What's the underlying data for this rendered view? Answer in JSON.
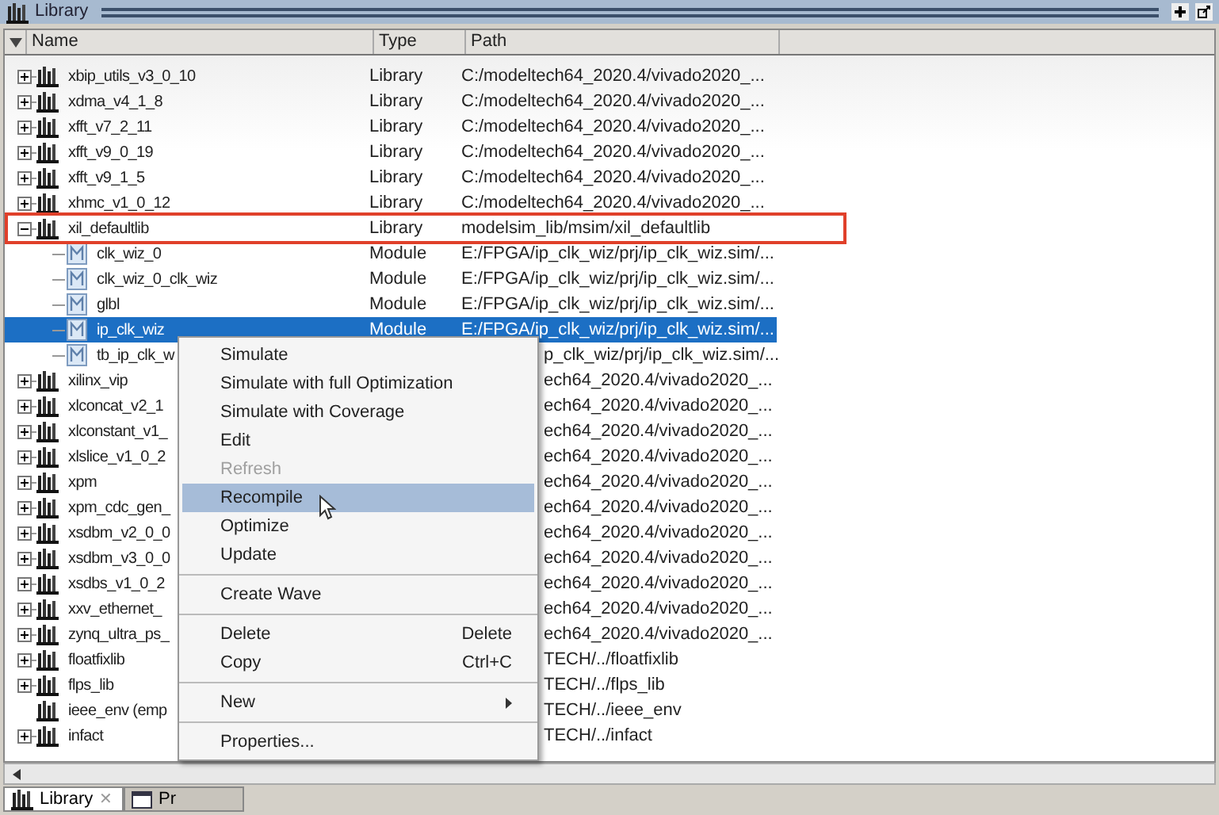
{
  "panel": {
    "title": "Library"
  },
  "columns": [
    "Name",
    "Type",
    "Path"
  ],
  "rows": [
    {
      "kind": "library",
      "name": "xbip_utils_v3_0_10",
      "type": "Library",
      "path": "C:/modeltech64_2020.4/vivado2020_...",
      "expandable": true,
      "expanded": false,
      "selected": false,
      "highlighted": false
    },
    {
      "kind": "library",
      "name": "xdma_v4_1_8",
      "type": "Library",
      "path": "C:/modeltech64_2020.4/vivado2020_...",
      "expandable": true,
      "expanded": false,
      "selected": false,
      "highlighted": false
    },
    {
      "kind": "library",
      "name": "xfft_v7_2_11",
      "type": "Library",
      "path": "C:/modeltech64_2020.4/vivado2020_...",
      "expandable": true,
      "expanded": false,
      "selected": false,
      "highlighted": false
    },
    {
      "kind": "library",
      "name": "xfft_v9_0_19",
      "type": "Library",
      "path": "C:/modeltech64_2020.4/vivado2020_...",
      "expandable": true,
      "expanded": false,
      "selected": false,
      "highlighted": false
    },
    {
      "kind": "library",
      "name": "xfft_v9_1_5",
      "type": "Library",
      "path": "C:/modeltech64_2020.4/vivado2020_...",
      "expandable": true,
      "expanded": false,
      "selected": false,
      "highlighted": false
    },
    {
      "kind": "library",
      "name": "xhmc_v1_0_12",
      "type": "Library",
      "path": "C:/modeltech64_2020.4/vivado2020_...",
      "expandable": true,
      "expanded": false,
      "selected": false,
      "highlighted": false
    },
    {
      "kind": "library",
      "name": "xil_defaultlib",
      "type": "Library",
      "path": "modelsim_lib/msim/xil_defaultlib",
      "expandable": true,
      "expanded": true,
      "selected": false,
      "highlighted": true,
      "children": [
        {
          "kind": "module",
          "name": "clk_wiz_0",
          "type": "Module",
          "path": "E:/FPGA/ip_clk_wiz/prj/ip_clk_wiz.sim/...",
          "selected": false
        },
        {
          "kind": "module",
          "name": "clk_wiz_0_clk_wiz",
          "type": "Module",
          "path": "E:/FPGA/ip_clk_wiz/prj/ip_clk_wiz.sim/...",
          "selected": false
        },
        {
          "kind": "module",
          "name": "glbl",
          "type": "Module",
          "path": "E:/FPGA/ip_clk_wiz/prj/ip_clk_wiz.sim/...",
          "selected": false
        },
        {
          "kind": "module",
          "name": "ip_clk_wiz",
          "type": "Module",
          "path": "E:/FPGA/ip_clk_wiz/prj/ip_clk_wiz.sim/...",
          "selected": true
        },
        {
          "kind": "module",
          "name": "tb_ip_clk_w",
          "path": "p_clk_wiz/prj/ip_clk_wiz.sim/...",
          "selected": false
        }
      ]
    },
    {
      "kind": "library",
      "name": "xilinx_vip",
      "path": "ech64_2020.4/vivado2020_...",
      "expandable": true,
      "expanded": false,
      "selected": false,
      "highlighted": false
    },
    {
      "kind": "library",
      "name": "xlconcat_v2_1",
      "path": "ech64_2020.4/vivado2020_...",
      "expandable": true,
      "expanded": false,
      "selected": false,
      "highlighted": false
    },
    {
      "kind": "library",
      "name": "xlconstant_v1_",
      "path": "ech64_2020.4/vivado2020_...",
      "expandable": true,
      "expanded": false,
      "selected": false,
      "highlighted": false
    },
    {
      "kind": "library",
      "name": "xlslice_v1_0_2",
      "path": "ech64_2020.4/vivado2020_...",
      "expandable": true,
      "expanded": false,
      "selected": false,
      "highlighted": false
    },
    {
      "kind": "library",
      "name": "xpm",
      "path": "ech64_2020.4/vivado2020_...",
      "expandable": true,
      "expanded": false,
      "selected": false,
      "highlighted": false
    },
    {
      "kind": "library",
      "name": "xpm_cdc_gen_",
      "path": "ech64_2020.4/vivado2020_...",
      "expandable": true,
      "expanded": false,
      "selected": false,
      "highlighted": false
    },
    {
      "kind": "library",
      "name": "xsdbm_v2_0_0",
      "path": "ech64_2020.4/vivado2020_...",
      "expandable": true,
      "expanded": false,
      "selected": false,
      "highlighted": false
    },
    {
      "kind": "library",
      "name": "xsdbm_v3_0_0",
      "path": "ech64_2020.4/vivado2020_...",
      "expandable": true,
      "expanded": false,
      "selected": false,
      "highlighted": false
    },
    {
      "kind": "library",
      "name": "xsdbs_v1_0_2",
      "path": "ech64_2020.4/vivado2020_...",
      "expandable": true,
      "expanded": false,
      "selected": false,
      "highlighted": false
    },
    {
      "kind": "library",
      "name": "xxv_ethernet_",
      "path": "ech64_2020.4/vivado2020_...",
      "expandable": true,
      "expanded": false,
      "selected": false,
      "highlighted": false
    },
    {
      "kind": "library",
      "name": "zynq_ultra_ps_",
      "path": "ech64_2020.4/vivado2020_...",
      "expandable": true,
      "expanded": false,
      "selected": false,
      "highlighted": false
    },
    {
      "kind": "library",
      "name": "floatfixlib",
      "path": "TECH/../floatfixlib",
      "expandable": true,
      "expanded": false,
      "selected": false,
      "highlighted": false
    },
    {
      "kind": "library",
      "name": "flps_lib",
      "path": "TECH/../flps_lib",
      "expandable": true,
      "expanded": false,
      "selected": false,
      "highlighted": false
    },
    {
      "kind": "library",
      "name": "ieee_env (emp",
      "path": "TECH/../ieee_env",
      "expandable": false,
      "expanded": false,
      "selected": false,
      "highlighted": false
    },
    {
      "kind": "library",
      "name": "infact",
      "path": "TECH/../infact",
      "expandable": true,
      "expanded": false,
      "selected": false,
      "highlighted": false
    }
  ],
  "tabs": [
    {
      "label": "Library",
      "selected": true,
      "close": "✕"
    },
    {
      "label": "Pr",
      "selected": false
    }
  ],
  "context_menu": [
    {
      "kind": "item",
      "label": "Simulate",
      "disabled": false,
      "selected": false
    },
    {
      "kind": "item",
      "label": "Simulate with full Optimization",
      "disabled": false,
      "selected": false
    },
    {
      "kind": "item",
      "label": "Simulate with Coverage",
      "disabled": false,
      "selected": false
    },
    {
      "kind": "item",
      "label": "Edit",
      "disabled": false,
      "selected": false
    },
    {
      "kind": "item",
      "label": "Refresh",
      "disabled": true,
      "selected": false
    },
    {
      "kind": "item",
      "label": "Recompile",
      "disabled": false,
      "selected": true
    },
    {
      "kind": "item",
      "label": "Optimize",
      "disabled": false,
      "selected": false
    },
    {
      "kind": "item",
      "label": "Update",
      "disabled": false,
      "selected": false
    },
    {
      "kind": "separator"
    },
    {
      "kind": "item",
      "label": "Create Wave",
      "disabled": false,
      "selected": false
    },
    {
      "kind": "separator"
    },
    {
      "kind": "item",
      "label": "Delete",
      "shortcut": "Delete",
      "disabled": false,
      "selected": false
    },
    {
      "kind": "item",
      "label": "Copy",
      "shortcut": "Ctrl+C",
      "disabled": false,
      "selected": false
    },
    {
      "kind": "separator"
    },
    {
      "kind": "submenu",
      "label": "New",
      "disabled": false,
      "selected": false
    },
    {
      "kind": "separator"
    },
    {
      "kind": "item",
      "label": "Properties...",
      "disabled": false,
      "selected": false
    }
  ]
}
